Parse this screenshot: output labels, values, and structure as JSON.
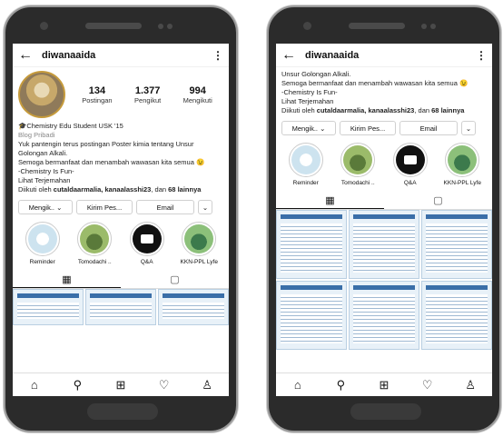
{
  "profiles": [
    {
      "username": "diwanaaida",
      "stats": [
        {
          "value": "134",
          "label": "Postingan"
        },
        {
          "value": "1.377",
          "label": "Pengikut"
        },
        {
          "value": "994",
          "label": "Mengikuti"
        }
      ],
      "bio_name": "Chemistry Edu Student USK '15",
      "bio_category": "Blog Pribadi",
      "bio_text": "Yuk pantengin terus postingan Poster kimia tentang Unsur Golongan Alkali.",
      "bio_line2": "Semoga bermanfaat dan menambah wawasan kita semua 😉",
      "bio_line3": "-Chemistry Is Fun-",
      "see_translation": "Lihat Terjemahan",
      "followed_by_prefix": "Diikuti oleh",
      "followed_by_names": "cutaldaarmalia, kanaalasshi23",
      "followed_by_suffix": ", dan",
      "followed_by_more": "68 lainnya",
      "buttons": [
        "Mengik.. ⌄",
        "Kirim Pes...",
        "Email",
        "⌄"
      ],
      "highlights": [
        "Reminder",
        "Tomodachi ..",
        "Q&A",
        "KKN-PPL Lyfe"
      ]
    },
    {
      "username": "diwanaaida",
      "bio_text": "Unsur Golongan Alkali.",
      "bio_line2": "Semoga bermanfaat dan menambah wawasan kita semua 😉",
      "bio_line3": "-Chemistry Is Fun-",
      "see_translation": "Lihat Terjemahan",
      "followed_by_prefix": "Diikuti oleh",
      "followed_by_names": "cutaldaarmalia, kanaalasshi23",
      "followed_by_suffix": ", dan",
      "followed_by_more": "68 lainnya",
      "buttons": [
        "Mengik.. ⌄",
        "Kirim Pes...",
        "Email",
        "⌄"
      ],
      "highlights": [
        "Reminder",
        "Tomodachi ..",
        "Q&A",
        "KKN-PPL Lyfe"
      ]
    }
  ],
  "icons": {
    "back": "←",
    "more": "⋮",
    "grid": "▦",
    "tagged": "▢",
    "home": "⌂",
    "search": "⚲",
    "add": "⊞",
    "heart": "♡",
    "profile": "♙"
  }
}
